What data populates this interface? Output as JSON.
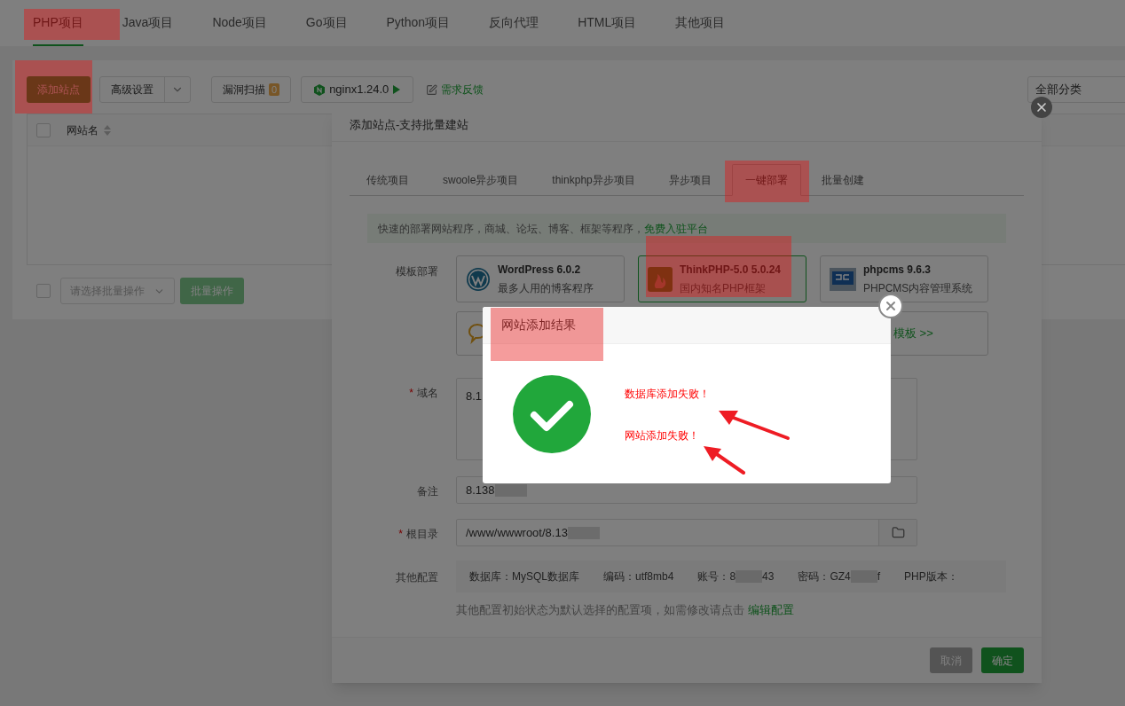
{
  "project_tabs": [
    {
      "label": "PHP项目",
      "selected": true
    },
    {
      "label": "Java项目",
      "selected": false
    },
    {
      "label": "Node项目",
      "selected": false
    },
    {
      "label": "Go项目",
      "selected": false
    },
    {
      "label": "Python项目",
      "selected": false
    },
    {
      "label": "反向代理",
      "selected": false
    },
    {
      "label": "HTML项目",
      "selected": false
    },
    {
      "label": "其他项目",
      "selected": false
    }
  ],
  "toolbar": {
    "add_site": "添加站点",
    "advanced": "高级设置",
    "scan": {
      "label": "漏洞扫描",
      "count": "0"
    },
    "nginx": "nginx1.24.0",
    "feedback": "需求反馈",
    "category": "全部分类"
  },
  "table": {
    "select_all_checked": false,
    "columns": [
      "网站名"
    ]
  },
  "bulk": {
    "checked": false,
    "placeholder": "请选择批量操作",
    "button": "批量操作"
  },
  "add_site_dialog": {
    "title": "添加站点-支持批量建站",
    "tabs": [
      {
        "label": "传统项目",
        "selected": false
      },
      {
        "label": "swoole异步项目",
        "selected": false
      },
      {
        "label": "thinkphp异步项目",
        "selected": false
      },
      {
        "label": "异步项目",
        "selected": false
      },
      {
        "label": "一键部署",
        "selected": true
      },
      {
        "label": "批量创建",
        "selected": false
      }
    ],
    "notice": {
      "text": "快速的部署网站程序，商城、论坛、博客、框架等程序，",
      "link": "免费入驻平台"
    },
    "template_label": "模板部署",
    "templates": [
      {
        "kind": "wordpress",
        "name": "WordPress 6.0.2",
        "desc": "最多人用的博客程序",
        "selected": false
      },
      {
        "kind": "thinkphp",
        "name": "ThinkPHP-5.0 5.0.24",
        "desc": "国内知名PHP框架",
        "selected": true
      },
      {
        "kind": "phpcms",
        "name": "phpcms 9.6.3",
        "desc": "PHPCMS内容管理系统",
        "selected": false
      },
      {
        "kind": "chat"
      },
      {
        "kind": "hidden"
      },
      {
        "kind": "more",
        "link": "模板 >>"
      }
    ],
    "fields": [
      {
        "kind": "textarea",
        "label": "域名",
        "required_mark": "*",
        "value": "8.1"
      },
      {
        "kind": "input",
        "label": "备注",
        "value": "8.138",
        "redacted": true
      },
      {
        "kind": "path",
        "label": "根目录",
        "required_mark": "*",
        "value": "/www/wwwroot/8.13",
        "redacted": true
      }
    ],
    "other_config": {
      "label": "其他配置",
      "items": [
        {
          "text": "数据库：MySQL数据库"
        },
        {
          "text": "编码：utf8mb4"
        },
        {
          "text": "账号：8",
          "text_after": "43"
        },
        {
          "text": "密码：GZ4",
          "text_after": "f"
        },
        {
          "text": "PHP版本："
        }
      ],
      "hint": "其他配置初始状态为默认选择的配置项，如需修改请点击",
      "hint_link": "编辑配置"
    },
    "buttons": [
      {
        "kind": "cancel",
        "label": "取消"
      },
      {
        "kind": "confirm",
        "label": "确定"
      }
    ]
  },
  "result_dialog": {
    "title": "网站添加结果",
    "messages": [
      "数据库添加失败！",
      "网站添加失败！"
    ]
  }
}
